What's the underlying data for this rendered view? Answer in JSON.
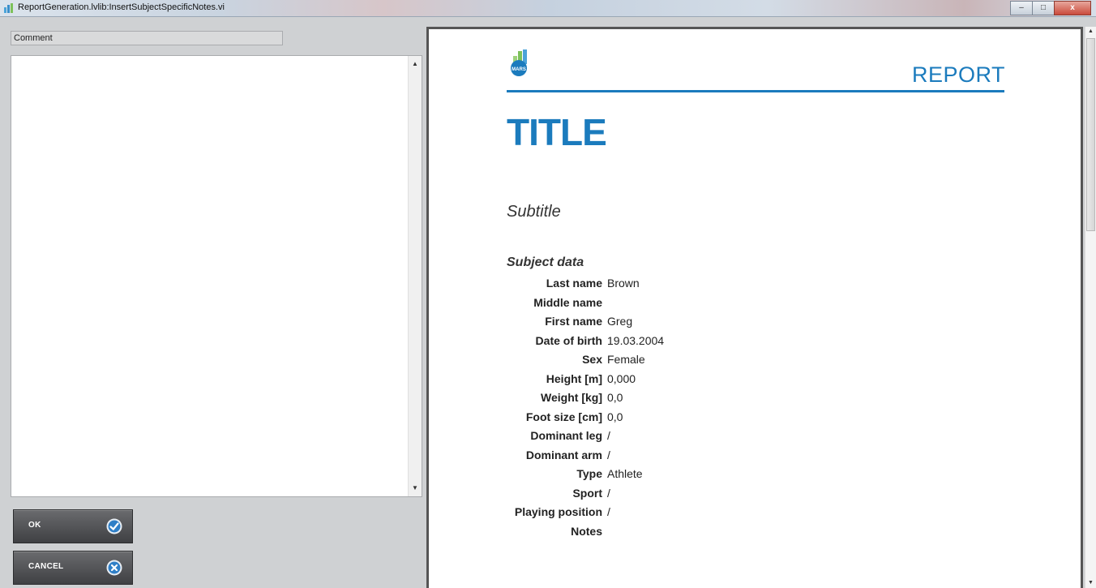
{
  "window": {
    "title": "ReportGeneration.lvlib:InsertSubjectSpecificNotes.vi",
    "controls": {
      "minimize": "–",
      "maximize": "□",
      "close": "x"
    }
  },
  "left_panel": {
    "comment_label": "Comment",
    "comment_value": "",
    "ok_label": "OK",
    "cancel_label": "CANCEL"
  },
  "report": {
    "logo_text": "MARS",
    "header_word": "REPORT",
    "title": "TITLE",
    "subtitle": "Subtitle",
    "section": "Subject data",
    "fields": [
      {
        "label": "Last name",
        "value": "Brown"
      },
      {
        "label": "Middle name",
        "value": ""
      },
      {
        "label": "First name",
        "value": "Greg"
      },
      {
        "label": "Date of birth",
        "value": "19.03.2004"
      },
      {
        "label": "Sex",
        "value": "Female"
      },
      {
        "label": "Height [m]",
        "value": "0,000"
      },
      {
        "label": "Weight [kg]",
        "value": "0,0"
      },
      {
        "label": "Foot size [cm]",
        "value": "0,0"
      },
      {
        "label": "Dominant leg",
        "value": "/"
      },
      {
        "label": "Dominant arm",
        "value": "/"
      },
      {
        "label": "Type",
        "value": "Athlete"
      },
      {
        "label": "Sport",
        "value": "/"
      },
      {
        "label": "Playing position",
        "value": "/"
      },
      {
        "label": "Notes",
        "value": ""
      }
    ]
  },
  "colors": {
    "accent": "#1b7bbd",
    "button_dark": "#4a4b4e",
    "ok_icon": "#2f7fc7",
    "cancel_icon": "#2f7fc7"
  }
}
